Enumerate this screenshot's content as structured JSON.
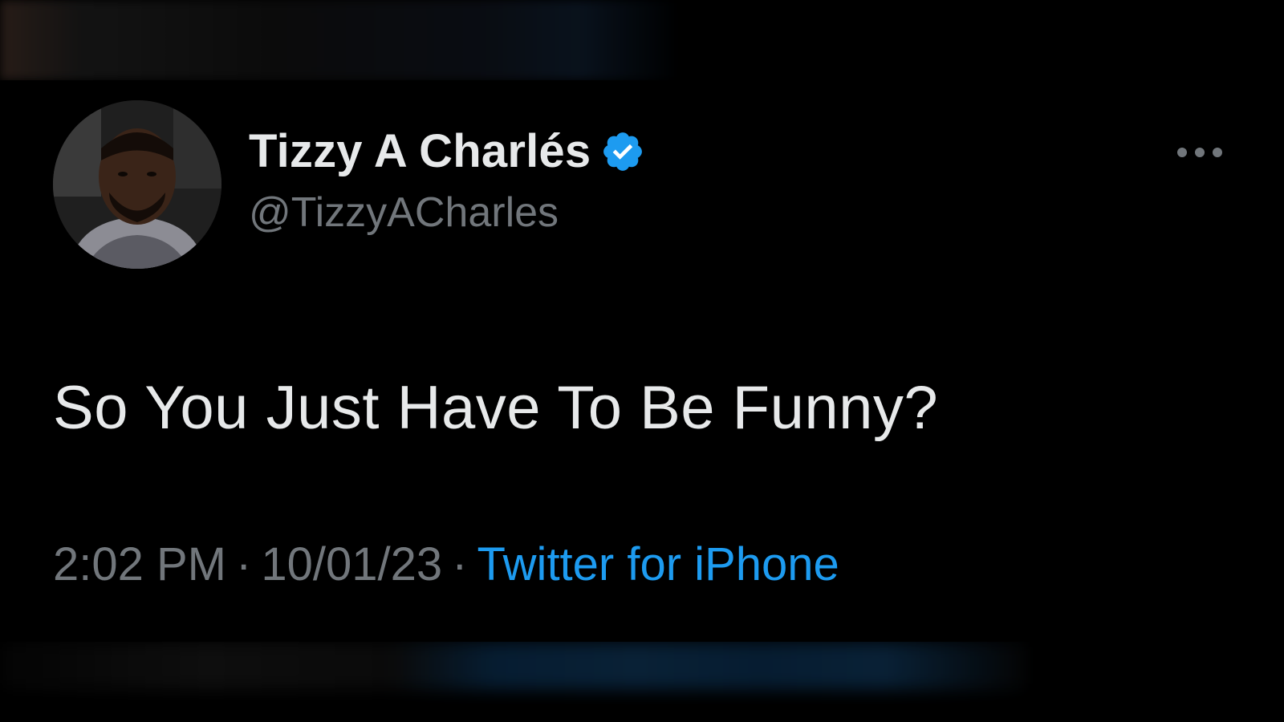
{
  "tweet": {
    "display_name": "Tizzy A Charlés",
    "handle": "@TizzyACharles",
    "text": "So You Just Have To Be Funny?",
    "time": "2:02 PM",
    "date": "10/01/23",
    "separator": "·",
    "source": "Twitter for iPhone"
  },
  "icons": {
    "verified": "verified-badge-icon",
    "more": "more-options-icon"
  },
  "colors": {
    "background": "#000000",
    "primary_text": "#e7e9ea",
    "secondary_text": "#71767b",
    "accent": "#1d9bf0"
  }
}
